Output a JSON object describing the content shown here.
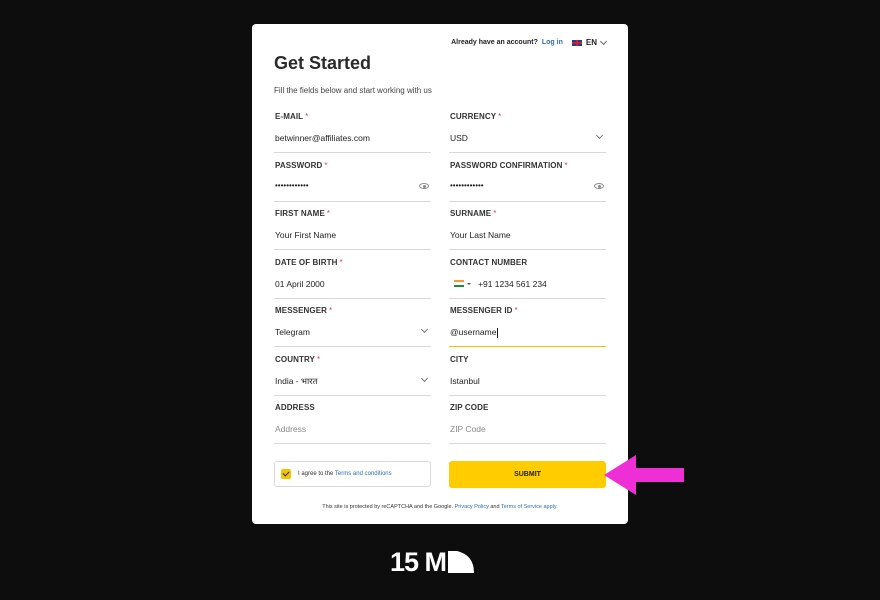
{
  "header": {
    "have_account": "Already have an account?",
    "login": "Log in",
    "language": "EN"
  },
  "title": "Get Started",
  "subtitle": "Fill the fields below and start working with us",
  "fields": {
    "email": {
      "label": "E-MAIL",
      "required": "*",
      "value": "betwinner@affiliates.com"
    },
    "currency": {
      "label": "CURRENCY",
      "required": "*",
      "value": "USD"
    },
    "password": {
      "label": "PASSWORD",
      "required": "*",
      "value": "••••••••••••"
    },
    "password_confirmation": {
      "label": "PASSWORD CONFIRMATION",
      "required": "*",
      "value": "••••••••••••"
    },
    "first_name": {
      "label": "FIRST NAME",
      "required": "*",
      "value": "Your First Name"
    },
    "surname": {
      "label": "SURNAME",
      "required": "*",
      "value": "Your Last Name"
    },
    "date_of_birth": {
      "label": "DATE OF BIRTH",
      "required": "*",
      "value": "01 April 2000"
    },
    "contact_number": {
      "label": "CONTACT NUMBER",
      "value": "+91 1234 561 234"
    },
    "messenger": {
      "label": "MESSENGER",
      "required": "*",
      "value": "Telegram"
    },
    "messenger_id": {
      "label": "MESSENGER ID",
      "required": "*",
      "value": "@username"
    },
    "country": {
      "label": "COUNTRY",
      "required": "*",
      "value": "India - भारत"
    },
    "city": {
      "label": "CITY",
      "value": "Istanbul"
    },
    "address": {
      "label": "ADDRESS",
      "placeholder": "Address"
    },
    "zip_code": {
      "label": "ZIP CODE",
      "placeholder": "ZIP Code"
    }
  },
  "agree": {
    "text": "I agree to the",
    "link": "Terms and conditions"
  },
  "submit_label": "SUBMIT",
  "recaptcha": {
    "text": "This site is protected by reCAPTCHA and the Google",
    "privacy": "Privacy Policy",
    "and": "and",
    "terms": "Terms of Service apply."
  },
  "logo_text": "15 M",
  "colors": {
    "accent_yellow": "#ffcc00",
    "arrow_magenta": "#ee2fd6",
    "link_blue": "#2a6ebb",
    "required_red": "#e0434f"
  },
  "icons": [
    "uk-flag-icon",
    "chevron-down-icon",
    "eye-icon",
    "india-flag-icon",
    "check-icon",
    "arrow-left-icon",
    "logo-mark-icon"
  ]
}
